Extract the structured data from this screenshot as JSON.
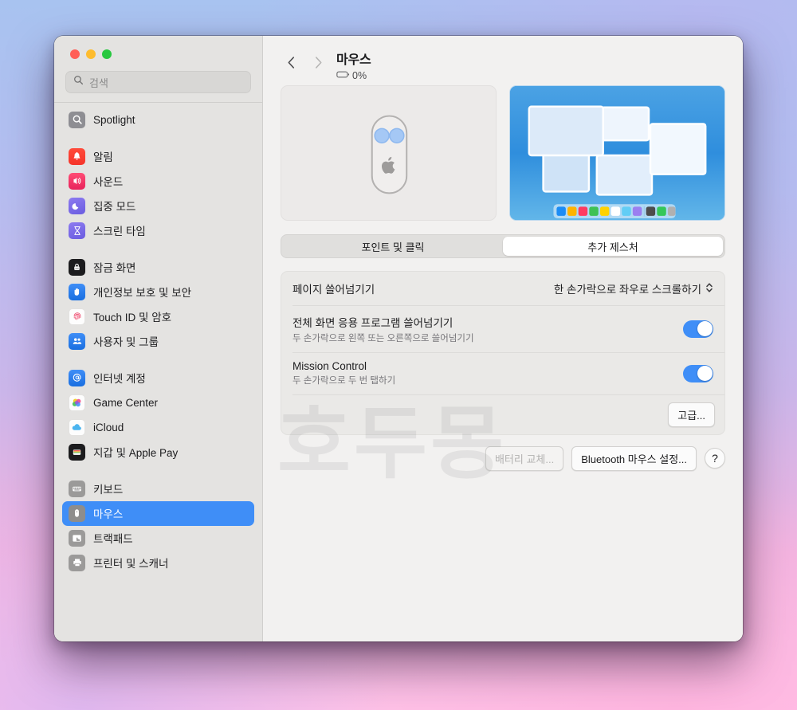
{
  "window": {
    "traffic_lights": [
      "close",
      "minimize",
      "maximize"
    ],
    "colors": {
      "accent": "#3f8ef7",
      "sidebar_bg": "#e4e3e1",
      "detail_bg": "#f2f1f0"
    }
  },
  "search": {
    "placeholder": "검색",
    "icon": "search-icon"
  },
  "sidebar": {
    "groups": [
      {
        "items": [
          {
            "label": "Spotlight",
            "icon": "spotlight-icon",
            "selected": false
          }
        ]
      },
      {
        "items": [
          {
            "label": "알림",
            "icon": "notifications-icon",
            "selected": false
          },
          {
            "label": "사운드",
            "icon": "sound-icon",
            "selected": false
          },
          {
            "label": "집중 모드",
            "icon": "focus-icon",
            "selected": false
          },
          {
            "label": "스크린 타임",
            "icon": "screen-time-icon",
            "selected": false
          }
        ]
      },
      {
        "items": [
          {
            "label": "잠금 화면",
            "icon": "lock-screen-icon",
            "selected": false
          },
          {
            "label": "개인정보 보호 및 보안",
            "icon": "privacy-security-icon",
            "selected": false
          },
          {
            "label": "Touch ID 및 암호",
            "icon": "touch-id-icon",
            "selected": false
          },
          {
            "label": "사용자 및 그룹",
            "icon": "users-groups-icon",
            "selected": false
          }
        ]
      },
      {
        "items": [
          {
            "label": "인터넷 계정",
            "icon": "internet-accounts-icon",
            "selected": false
          },
          {
            "label": "Game Center",
            "icon": "game-center-icon",
            "selected": false
          },
          {
            "label": "iCloud",
            "icon": "icloud-icon",
            "selected": false
          },
          {
            "label": "지갑 및 Apple Pay",
            "icon": "wallet-apple-pay-icon",
            "selected": false
          }
        ]
      },
      {
        "items": [
          {
            "label": "키보드",
            "icon": "keyboard-icon",
            "selected": false
          },
          {
            "label": "마우스",
            "icon": "mouse-icon",
            "selected": true
          },
          {
            "label": "트랙패드",
            "icon": "trackpad-icon",
            "selected": false
          },
          {
            "label": "프린터 및 스캐너",
            "icon": "printer-scanner-icon",
            "selected": false
          }
        ]
      }
    ]
  },
  "header": {
    "back_icon": "chevron-left-icon",
    "forward_icon": "chevron-right-icon",
    "title": "마우스",
    "battery_icon": "battery-icon",
    "battery_level": "0%"
  },
  "illustrations": {
    "mouse": {
      "name": "magic-mouse-illustration",
      "logo": "apple-logo"
    },
    "desktop": {
      "name": "mission-control-illustration",
      "dock_colors": [
        "#1b8cf5",
        "#ffb300",
        "#ff3b60",
        "#3fc154",
        "#ffd200",
        "#ffffff",
        "#62cdf5",
        "#9b7ff0",
        "#4d4d4d",
        "#34c759",
        "#b0b0b0"
      ]
    }
  },
  "tabs": [
    {
      "label": "포인트 및 클릭",
      "active": false
    },
    {
      "label": "추가 제스처",
      "active": true
    }
  ],
  "settings": {
    "rows": [
      {
        "label": "페이지 쓸어넘기기",
        "type": "popup",
        "value": "한 손가락으로 좌우로 스크롤하기"
      },
      {
        "label": "전체 화면 응용 프로그램 쓸어넘기기",
        "sub": "두 손가락으로 왼쪽 또는 오른쪽으로 쓸어넘기기",
        "type": "toggle",
        "value": "on"
      },
      {
        "label": "Mission Control",
        "sub": "두 손가락으로 두 번 탭하기",
        "type": "toggle",
        "value": "on"
      }
    ],
    "advanced_button": "고급..."
  },
  "bottom_buttons": [
    {
      "label": "배터리 교체...",
      "disabled": true
    },
    {
      "label": "Bluetooth 마우스 설정...",
      "disabled": false
    }
  ],
  "help_button": {
    "label": "?"
  },
  "watermark": {
    "text": "호두몽"
  }
}
